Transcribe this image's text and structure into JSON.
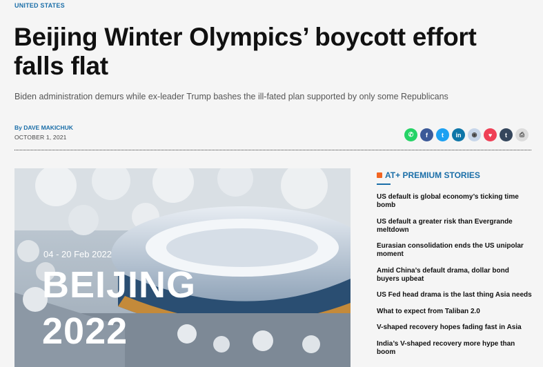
{
  "article": {
    "category": "UNITED STATES",
    "headline": "Beijing Winter Olympics’ boycott effort falls flat",
    "subheadline": "Biden administration demurs while ex-leader Trump bashes the ill-fated plan supported by only some Republicans",
    "byline_prefix": "By ",
    "author": "DAVE MAKICHUK",
    "date": "OCTOBER 1, 2021"
  },
  "share": [
    {
      "icon": "whatsapp-icon",
      "glyph": "✆",
      "color": "#25d366"
    },
    {
      "icon": "facebook-icon",
      "glyph": "f",
      "color": "#3b5998"
    },
    {
      "icon": "twitter-icon",
      "glyph": "t",
      "color": "#1da1f2"
    },
    {
      "icon": "linkedin-icon",
      "glyph": "in",
      "color": "#0e76a8"
    },
    {
      "icon": "reddit-icon",
      "glyph": "◉",
      "color": "#c7d6ea"
    },
    {
      "icon": "pocket-icon",
      "glyph": "♥",
      "color": "#ef4056"
    },
    {
      "icon": "tumblr-icon",
      "glyph": "t",
      "color": "#35465c"
    },
    {
      "icon": "print-icon",
      "glyph": "⎙",
      "color": "#dcdcdc"
    }
  ],
  "hero": {
    "dates": "04 - 20 Feb 2022",
    "city": "BEIJING",
    "year": "2022"
  },
  "sidebar": {
    "title": "AT+ PREMIUM STORIES",
    "stories": [
      "US default is global economy’s ticking time bomb",
      "US default a greater risk than Evergrande meltdown",
      "Eurasian consolidation ends the US unipolar moment",
      "Amid China’s default drama, dollar bond buyers upbeat",
      "US Fed head drama is the last thing Asia needs",
      "What to expect from Taliban 2.0",
      "V-shaped recovery hopes fading fast in Asia",
      "India’s V-shaped recovery more hype than boom"
    ]
  }
}
